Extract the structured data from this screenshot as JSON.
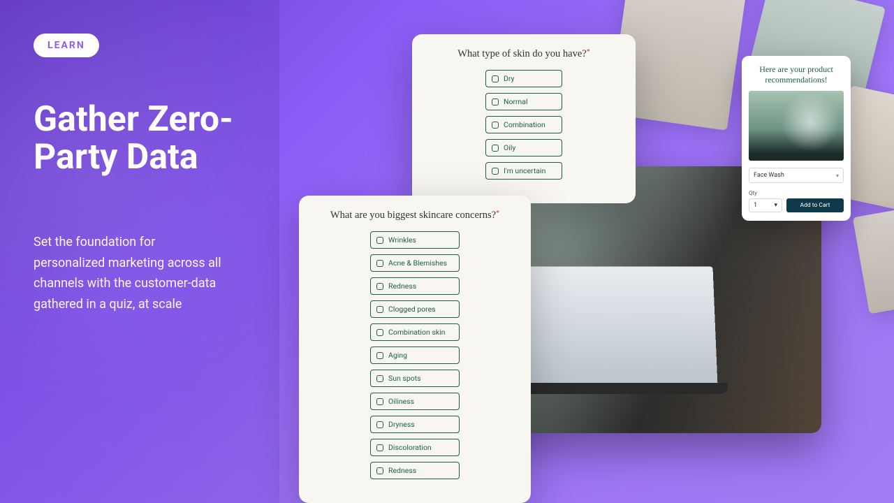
{
  "badge": "LEARN",
  "headline": "Gather Zero-Party Data",
  "subhead": "Set the foundation for personalized marketing across all channels with the customer-data gathered in a quiz, at scale",
  "quiz1": {
    "question": "What type of skin do you have?",
    "options": [
      "Dry",
      "Normal",
      "Combination",
      "Oily",
      "I'm uncertain"
    ]
  },
  "quiz2": {
    "question": "What are you biggest skincare concerns?",
    "options": [
      "Wrinkles",
      "Acne & Blemishes",
      "Redness",
      "Clogged pores",
      "Combination skin",
      "Aging",
      "Sun spots",
      "Oiliness",
      "Dryness",
      "Discoloration",
      "Redness"
    ]
  },
  "rec": {
    "title": "Here are your product recommendations!",
    "product": "Face Wash",
    "qty_label": "Qty",
    "qty_value": "1",
    "add_label": "Add to Cart"
  }
}
